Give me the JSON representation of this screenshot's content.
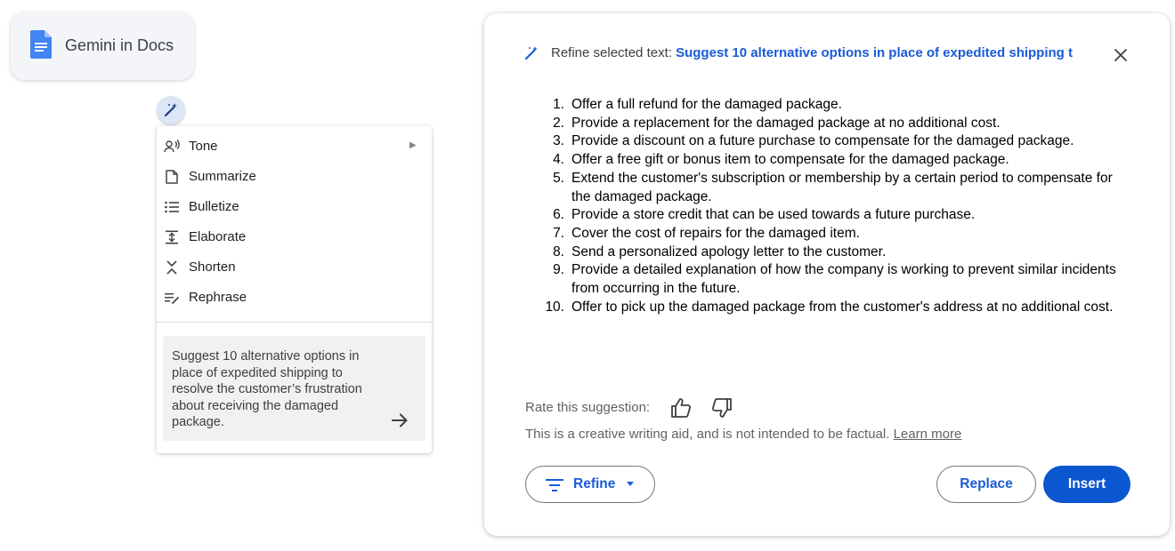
{
  "chip": {
    "label": "Gemini in Docs"
  },
  "menu": {
    "items": [
      {
        "label": "Tone",
        "icon": "tone-icon",
        "has_submenu": true
      },
      {
        "label": "Summarize",
        "icon": "summarize-icon"
      },
      {
        "label": "Bulletize",
        "icon": "bulletize-icon"
      },
      {
        "label": "Elaborate",
        "icon": "elaborate-icon"
      },
      {
        "label": "Shorten",
        "icon": "shorten-icon"
      },
      {
        "label": "Rephrase",
        "icon": "rephrase-icon"
      }
    ],
    "submenu_arrow": "▶",
    "prompt": "Suggest 10 alternative options in place of expedited shipping to resolve the customer’s frustration about receiving the damaged package."
  },
  "panel": {
    "header_prefix": "Refine selected text:",
    "header_selected": "Suggest 10 alternative options in place of expedited shipping t",
    "suggestions": [
      {
        "num": "1.",
        "text": "Offer a full refund for the damaged package."
      },
      {
        "num": "2.",
        "text": "Provide a replacement for the damaged package at no additional cost."
      },
      {
        "num": "3.",
        "text": "Provide a discount on a future purchase to compensate for the damaged package."
      },
      {
        "num": "4.",
        "text": "Offer a free gift or bonus item to compensate for the damaged package."
      },
      {
        "num": "5.",
        "text": "Extend the customer's subscription or membership by a certain period to compensate for the damaged package."
      },
      {
        "num": "6.",
        "text": "Provide a store credit that can be used towards a future purchase."
      },
      {
        "num": "7.",
        "text": "Cover the cost of repairs for the damaged item."
      },
      {
        "num": "8.",
        "text": "Send a personalized apology letter to the customer."
      },
      {
        "num": "9.",
        "text": "Provide a detailed explanation of how the company is working to prevent similar incidents from occurring in the future."
      },
      {
        "num": "10.",
        "text": "Offer to pick up the damaged package from the customer's address at no additional cost."
      }
    ],
    "rate_label": "Rate this suggestion:",
    "disclaimer": "This is a creative writing aid, and is not intended to be factual.",
    "learn_more": "Learn more",
    "refine_label": "Refine",
    "replace_label": "Replace",
    "insert_label": "Insert"
  },
  "colors": {
    "accent_blue": "#1a5bd6",
    "insert_bg": "#0b57d0",
    "docs_blue": "#4285f4",
    "wand_bg": "#dbe6f6"
  }
}
